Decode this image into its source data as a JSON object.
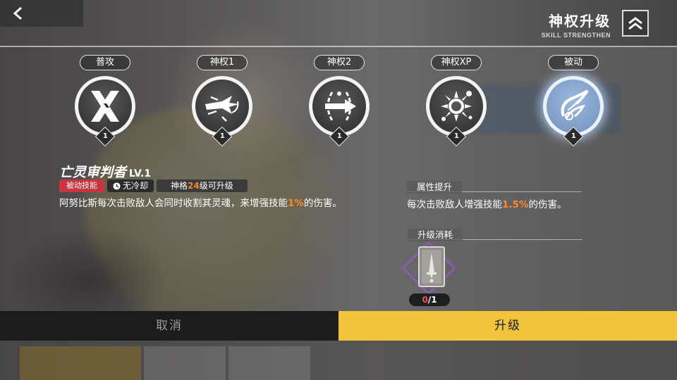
{
  "header": {
    "title": "神权升级",
    "subtitle": "SKILL STRENGTHEN"
  },
  "skills": [
    {
      "label": "普攻",
      "level": "1",
      "icon": "cross-slash-icon"
    },
    {
      "label": "神权1",
      "level": "1",
      "icon": "dash-strike-icon"
    },
    {
      "label": "神权2",
      "level": "1",
      "icon": "shield-spear-icon"
    },
    {
      "label": "神权XP",
      "level": "1",
      "icon": "sun-burst-icon"
    },
    {
      "label": "被动",
      "level": "1",
      "icon": "soul-swirl-icon"
    }
  ],
  "selected_skill": {
    "name": "亡灵审判者",
    "level": "LV.1",
    "type_tag": "被动技能",
    "cooldown": "无冷却",
    "upgrade_req_prefix": "神格",
    "upgrade_req_value": "24",
    "upgrade_req_suffix": "级可升级",
    "desc_prefix": "阿努比斯每次击败敌人会同时收割其灵魂，来增强技能",
    "desc_value": "1%",
    "desc_suffix": "的伤害。"
  },
  "attr_section": {
    "heading": "属性提升",
    "text_prefix": "每次击败敌人增强技能",
    "text_value": "1.5%",
    "text_suffix": "的伤害。"
  },
  "cost_section": {
    "heading": "升级消耗",
    "item_have": "0",
    "item_need": "/1"
  },
  "buttons": {
    "cancel": "取消",
    "upgrade": "升级"
  },
  "colors": {
    "accent_gold": "#f1c43c",
    "highlight_orange": "#ff8a2a",
    "tag_red": "#c8343f",
    "rarity_purple": "#a45be8"
  }
}
